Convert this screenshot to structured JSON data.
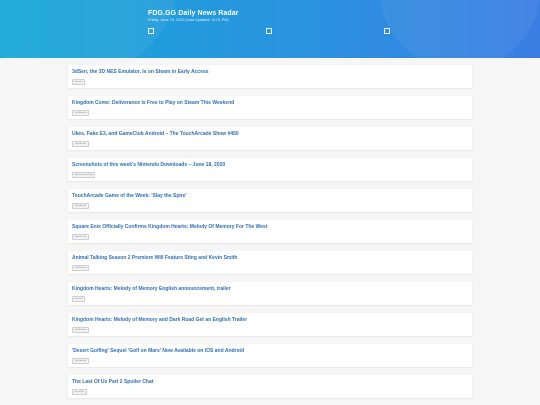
{
  "header": {
    "title": "FDG.GG Daily News Radar",
    "subtitle": "Friday, June 19, 2020 (Last Updated: 11:01 PM)"
  },
  "articles": [
    {
      "title": "3dSen, the 3D NES Emulator, Is on Steam in Early Access",
      "tag": "Gematsu"
    },
    {
      "title": "Kingdom Come: Deliverance is Free to Play on Steam This Weekend",
      "tag": "DualShockers"
    },
    {
      "title": "Ukes, Fake E3, and GameClub Android – The TouchArcade Show #450",
      "tag": "TouchArcade"
    },
    {
      "title": "Screenshots of this week's Nintendo Downloads – June 18, 2020",
      "tag": "Nintendo Everything"
    },
    {
      "title": "TouchArcade Game of the Week: 'Slay the Spire'",
      "tag": "TouchArcade"
    },
    {
      "title": "Square Enix Officially Confirms Kingdom Hearts: Melody Of Memory For The West",
      "tag": "Nintendo Life"
    },
    {
      "title": "Animal Talking Season 2 Premiere Will Feature Sting and Kevin Smith",
      "tag": "DualShockers"
    },
    {
      "title": "Kingdom Hearts: Melody of Memory English announcement, trailer",
      "tag": "Gematsu"
    },
    {
      "title": "Kingdom Hearts: Melody of Memory and Dark Road Get an English Trailer",
      "tag": "DualShockers"
    },
    {
      "title": "'Desert Golfing' Sequel 'Golf on Mars' Now Available on iOS and Android",
      "tag": "TouchArcade"
    },
    {
      "title": "The Last Of Us Part 2 Spoiler Chat",
      "tag": "GameSpot"
    }
  ]
}
